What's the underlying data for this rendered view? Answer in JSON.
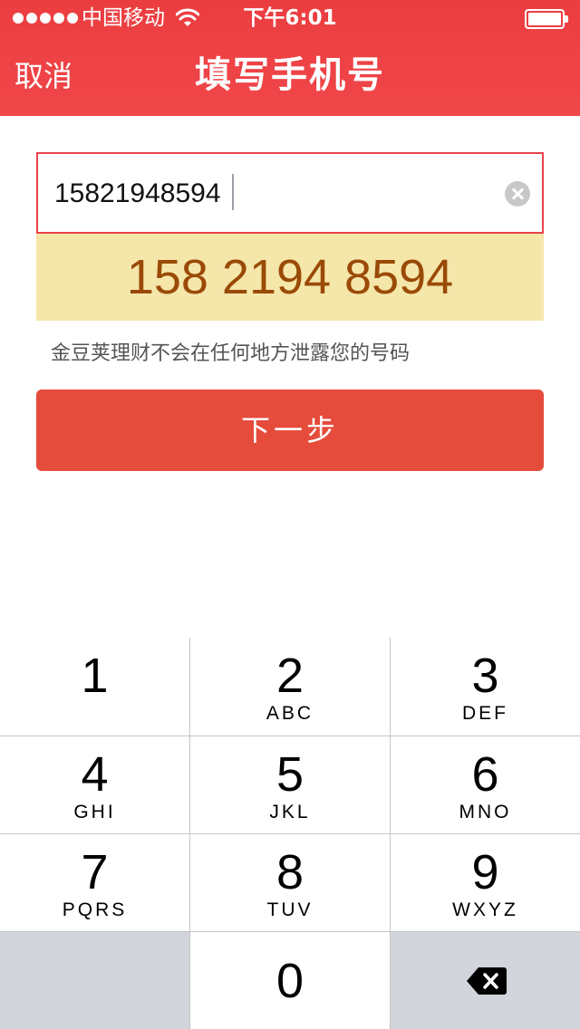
{
  "status_bar": {
    "carrier": "中国移动",
    "time": "下午6:01"
  },
  "nav": {
    "cancel_label": "取消",
    "title": "填写手机号"
  },
  "phone": {
    "value": "15821948594",
    "formatted": "158 2194 8594"
  },
  "privacy_note": "金豆荚理财不会在任何地方泄露您的号码",
  "next_button_label": "下一步",
  "keypad": {
    "keys": [
      {
        "digit": "1",
        "letters": ""
      },
      {
        "digit": "2",
        "letters": "ABC"
      },
      {
        "digit": "3",
        "letters": "DEF"
      },
      {
        "digit": "4",
        "letters": "GHI"
      },
      {
        "digit": "5",
        "letters": "JKL"
      },
      {
        "digit": "6",
        "letters": "MNO"
      },
      {
        "digit": "7",
        "letters": "PQRS"
      },
      {
        "digit": "8",
        "letters": "TUV"
      },
      {
        "digit": "9",
        "letters": "WXYZ"
      },
      {
        "digit": "0",
        "letters": ""
      }
    ]
  },
  "colors": {
    "brand_red": "#eb3d40",
    "button_red": "#e64c3c",
    "highlight_bg": "#f5e6aa",
    "highlight_text": "#9a4a06"
  },
  "icons": {
    "wifi": "wifi-icon",
    "battery": "battery-icon",
    "clear": "clear-icon",
    "backspace": "backspace-icon"
  }
}
